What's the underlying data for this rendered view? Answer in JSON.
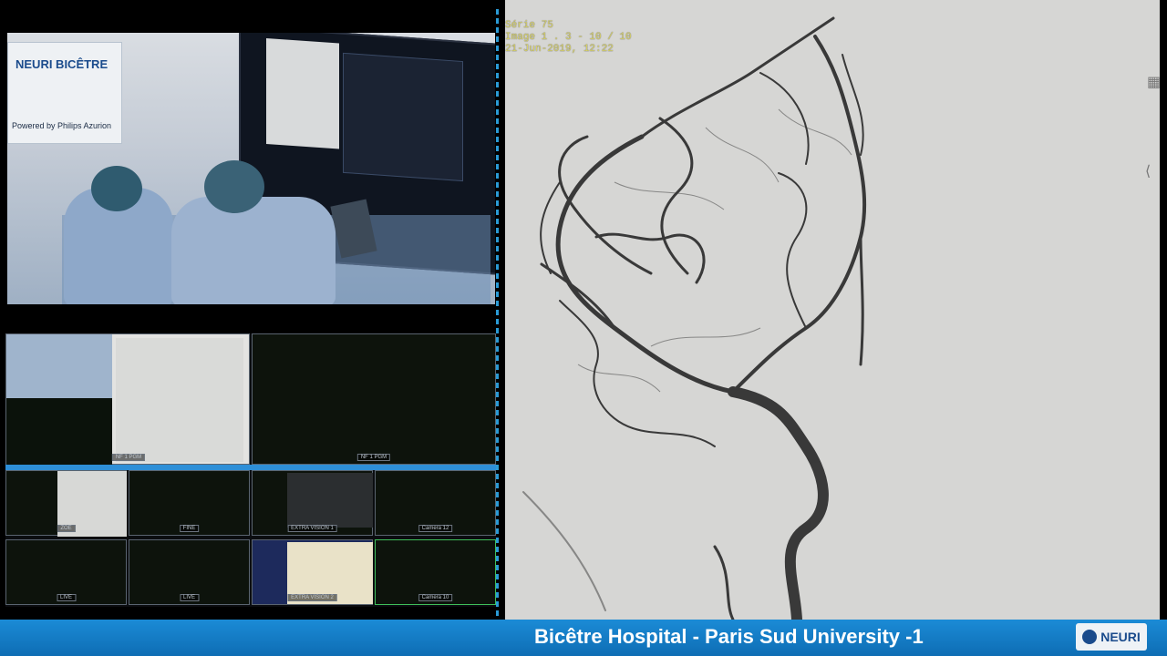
{
  "overlay": {
    "series": "Série 75",
    "image": "Image 1 . 3 - 10 / 10",
    "datetime": "21-Jun-2019, 12:22"
  },
  "camera_feed": {
    "banner_title": "NEURI BICÊTRE",
    "banner_subtitle": "Powered by Philips Azurion"
  },
  "grid": {
    "cells": [
      {
        "label": "NF 1 PGM"
      },
      {
        "label": "NF 1 PGM"
      },
      {
        "label": "ZOE"
      },
      {
        "label": "FINE"
      },
      {
        "label": "EXTRA VISION 1"
      },
      {
        "label": "Camera 12"
      },
      {
        "label": "LIVE"
      },
      {
        "label": "LIVE"
      },
      {
        "label": "EXTRA VISION 2"
      },
      {
        "label": "Camera 10"
      }
    ]
  },
  "bottom_bar": {
    "title": "Bicêtre Hospital - Paris Sud University -1",
    "brand": "NEURI"
  },
  "colors": {
    "accent_blue": "#1b8bd6",
    "overlay_text": "#d9d36a",
    "angio_background": "#d6d6d4"
  }
}
